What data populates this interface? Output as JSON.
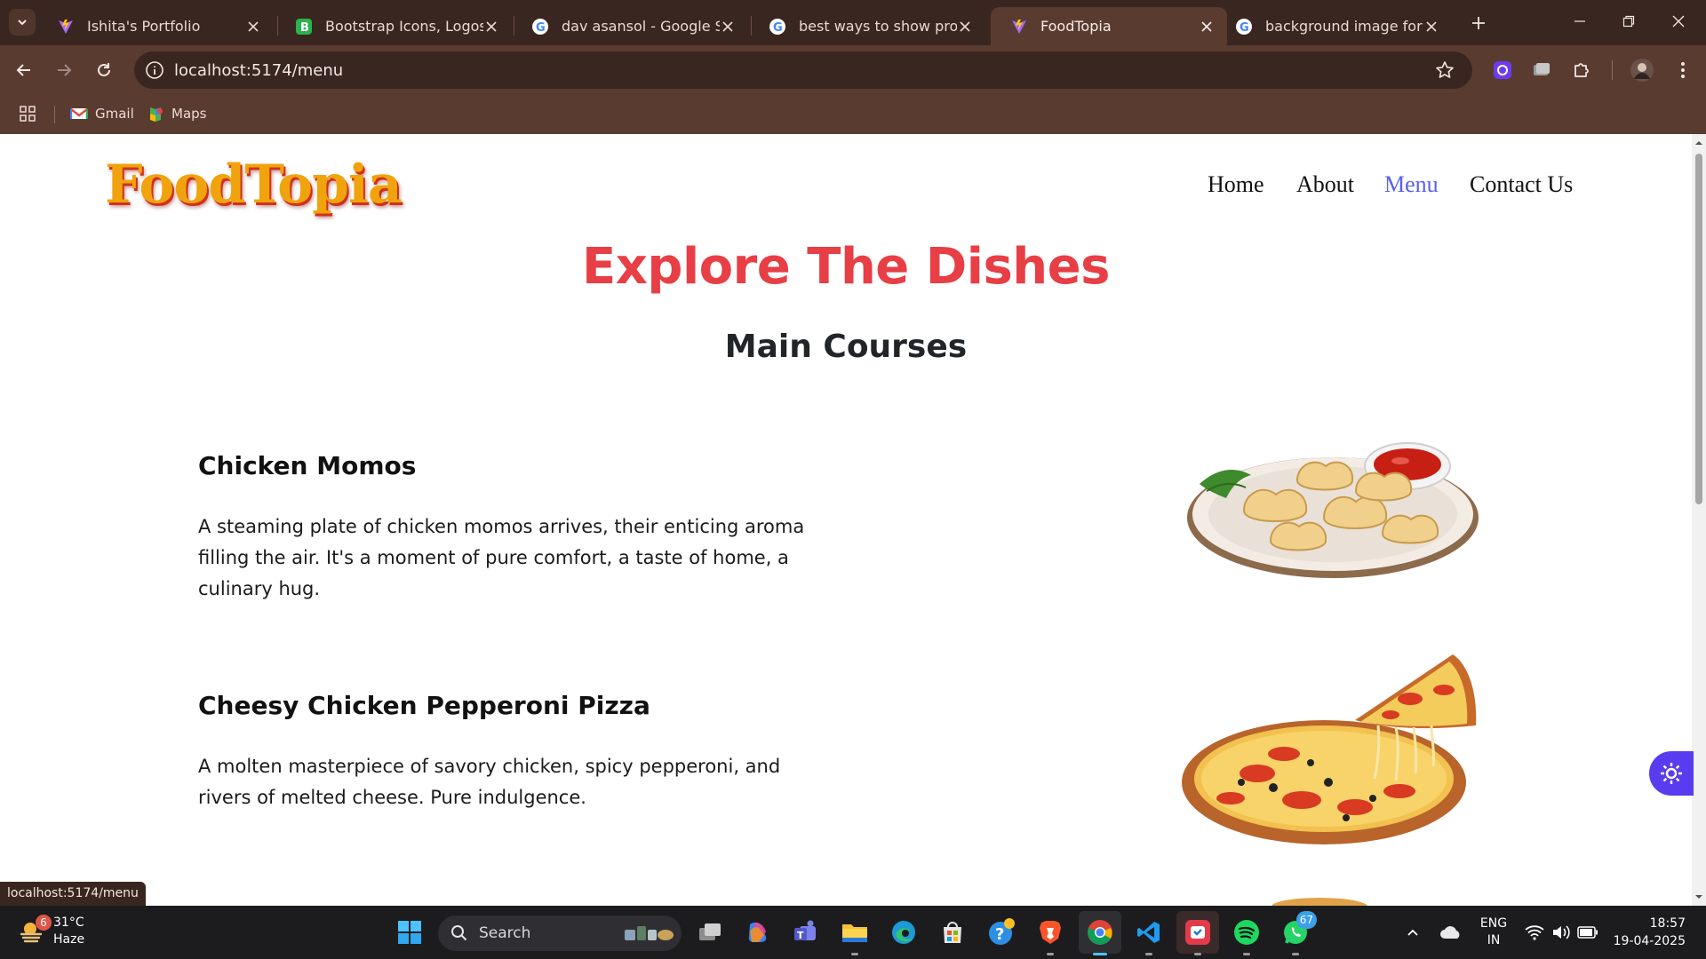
{
  "browser": {
    "tabs": [
      {
        "title": "Ishita's Portfolio",
        "favicon": "vite-icon"
      },
      {
        "title": "Bootstrap Icons, Logos, Sy",
        "favicon": "bootstrap-icon"
      },
      {
        "title": "dav asansol - Google Searc",
        "favicon": "google-icon"
      },
      {
        "title": "best ways to show projects",
        "favicon": "google-icon"
      },
      {
        "title": "FoodTopia",
        "favicon": "vite-icon",
        "active": true
      },
      {
        "title": "background image for wea",
        "favicon": "google-icon"
      }
    ],
    "url": "localhost:5174/menu",
    "bookmarks": [
      {
        "label": "Gmail",
        "icon": "gmail-icon"
      },
      {
        "label": "Maps",
        "icon": "maps-icon"
      }
    ],
    "status_url": "localhost:5174/menu"
  },
  "site": {
    "logo": "FoodTopia",
    "nav": [
      {
        "label": "Home"
      },
      {
        "label": "About"
      },
      {
        "label": "Menu",
        "active": true
      },
      {
        "label": "Contact Us"
      }
    ],
    "page_title": "Explore The Dishes",
    "section_title": "Main Courses",
    "dishes": [
      {
        "name": "Chicken Momos",
        "description": "A steaming plate of chicken momos arrives, their enticing aroma filling the air. It's a moment of pure comfort, a taste of home, a culinary hug.",
        "image": "momos-plate-image"
      },
      {
        "name": "Cheesy Chicken Pepperoni Pizza",
        "description": "A molten masterpiece of savory chicken, spicy pepperoni, and rivers of melted cheese. Pure indulgence.",
        "image": "pizza-image"
      }
    ],
    "colors": {
      "accent": "#e83e45",
      "nav_active": "#5a5df0",
      "logo": "#f0a30c"
    }
  },
  "taskbar": {
    "weather": {
      "temp": "31°C",
      "condition": "Haze",
      "badge": "6"
    },
    "search_label": "Search",
    "apps": [
      "windows-start-icon",
      "task-view-icon",
      "copilot-icon",
      "teams-icon",
      "file-explorer-icon",
      "edge-icon",
      "store-icon",
      "help-icon",
      "brave-icon",
      "chrome-icon",
      "vscode-icon",
      "app-icon",
      "spotify-icon",
      "whatsapp-icon"
    ],
    "whatsapp_badge": "67",
    "language": {
      "line1": "ENG",
      "line2": "IN"
    },
    "time": "18:57",
    "date": "19-04-2025"
  }
}
